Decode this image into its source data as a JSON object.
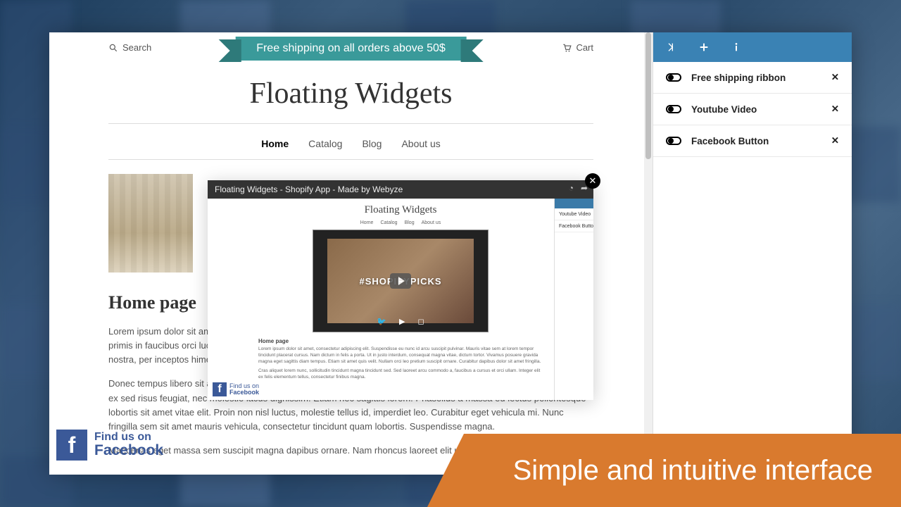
{
  "store": {
    "search_placeholder": "Search",
    "cart_label": "Cart",
    "ribbon_text": "Free shipping on all orders above 50$",
    "title": "Floating Widgets",
    "nav": [
      "Home",
      "Catalog",
      "Blog",
      "About us"
    ],
    "nav_active_index": 0,
    "page_heading": "Home page",
    "paragraphs": [
      "Lorem ipsum dolor sit amet lorem facilisis, vel pretium felis pharetra. Aliquam eget ultrices arcu. Vestibulum ante ipsum primis in faucibus orci luctus et ultrices posuere cubilia curae. Class aptent taciti sociosqu ad litora torquent per conubia nostra, per inceptos himenaeos. Sed porttitor ante quis facilisis vulputate.",
      "Donec tempus libero sit amet lorem facilisis, vel pretium felis pharetra. Aliquam eget ultrices arcu. Suspendisse cursus ex sed risus feugiat, nec molestie lacus dignissim. Etiam nec sagittis lorem. Phasellus a massa eu lectus pellentesque lobortis sit amet vitae elit. Proin non nisl luctus, molestie tellus id, imperdiet leo. Curabitur eget vehicula mi. Nunc fringilla sem sit amet mauris vehicula, consectetur tincidunt quam lobortis. Suspendisse magna.",
      "Maecenas eget massa sem suscipit magna dapibus ornare. Nam rhoncus laoreet elit ut viverra."
    ]
  },
  "video": {
    "title": "Floating Widgets - Shopify App - Made by Webyze",
    "mini_title": "Floating Widgets",
    "mini_nav": [
      "Home",
      "Catalog",
      "Blog",
      "About us"
    ],
    "thumb_tag": "#SHOPIFYPICKS",
    "side_items": [
      "Youtube Video",
      "Facebook Button"
    ],
    "mini_heading": "Home page",
    "find_us_label": "Find us on",
    "find_us_brand": "Facebook"
  },
  "sidebar": {
    "widgets": [
      {
        "label": "Free shipping ribbon",
        "enabled": true
      },
      {
        "label": "Youtube Video",
        "enabled": true
      },
      {
        "label": "Facebook Button",
        "enabled": true
      }
    ]
  },
  "fb_badge": {
    "line1": "Find us on",
    "line2": "Facebook"
  },
  "banner_text": "Simple and intuitive interface"
}
